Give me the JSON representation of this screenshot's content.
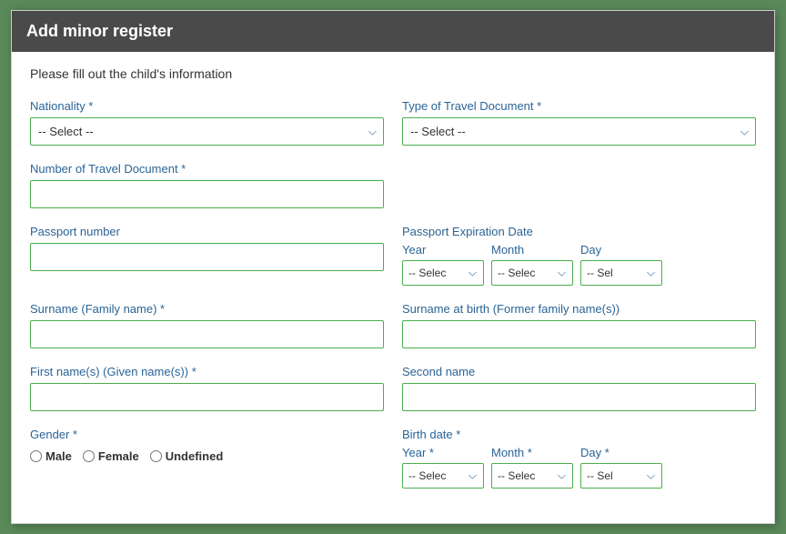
{
  "modal": {
    "title": "Add minor register",
    "subtitle": "Please fill out the child's information"
  },
  "form": {
    "nationality_label": "Nationality *",
    "nationality_placeholder": "-- Select --",
    "travel_doc_type_label": "Type of Travel Document *",
    "travel_doc_type_placeholder": "-- Select --",
    "travel_doc_number_label": "Number of Travel Document *",
    "passport_number_label": "Passport number",
    "passport_expiry_label": "Passport Expiration Date",
    "expiry_year_label": "Year",
    "expiry_year_placeholder": "-- Selec",
    "expiry_month_label": "Month",
    "expiry_month_placeholder": "-- Selec",
    "expiry_day_label": "Day",
    "expiry_day_placeholder": "-- Sel",
    "surname_label": "Surname (Family name) *",
    "surname_birth_label": "Surname at birth (Former family name(s))",
    "firstname_label": "First name(s) (Given name(s)) *",
    "secondname_label": "Second name",
    "gender_label": "Gender *",
    "gender_options": [
      "Male",
      "Female",
      "Undefined"
    ],
    "birthdate_label": "Birth date *",
    "birth_year_label": "Year *",
    "birth_year_placeholder": "-- Selec",
    "birth_month_label": "Month *",
    "birth_month_placeholder": "-- Selec",
    "birth_day_label": "Day *",
    "birth_day_placeholder": "-- Sel"
  }
}
